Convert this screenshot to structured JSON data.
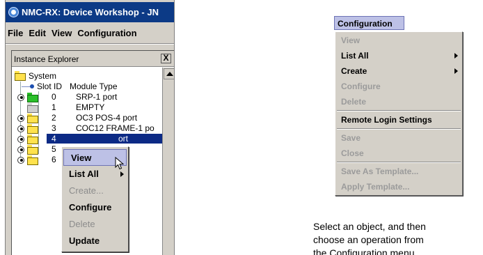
{
  "window": {
    "title": "NMC-RX: Device Workshop - JN",
    "menu": [
      "File",
      "Edit",
      "View",
      "Configuration"
    ]
  },
  "instance_explorer": {
    "title": "Instance Explorer",
    "close_label": "X",
    "root": "System",
    "columns": {
      "slot": "Slot ID",
      "module": "Module Type"
    },
    "rows": [
      {
        "slot": "0",
        "module": "SRP-1 port",
        "folder": "green",
        "expandable": true
      },
      {
        "slot": "1",
        "module": "EMPTY",
        "folder": "grey",
        "expandable": false
      },
      {
        "slot": "2",
        "module": "OC3 POS-4 port",
        "folder": "yellow",
        "expandable": true
      },
      {
        "slot": "3",
        "module": "COC12 FRAME-1 po",
        "folder": "yellow",
        "expandable": true
      },
      {
        "slot": "4",
        "module": "OC12 ATM-1 port",
        "folder": "yellow",
        "expandable": true,
        "selected": true
      },
      {
        "slot": "5",
        "module": "",
        "module_tail": "ort",
        "folder": "yellow",
        "expandable": true
      },
      {
        "slot": "6",
        "module": "",
        "folder": "yellow",
        "expandable": true
      }
    ],
    "row4_visible_tail": "ort"
  },
  "context_menu": {
    "items": [
      {
        "label": "View",
        "enabled": true,
        "hover": true
      },
      {
        "label": "List All",
        "enabled": true,
        "submenu": true
      },
      {
        "label": "Create...",
        "enabled": false
      },
      {
        "label": "Configure",
        "enabled": true
      },
      {
        "label": "Delete",
        "enabled": false
      },
      {
        "label": "Update",
        "enabled": true
      }
    ]
  },
  "configuration_menu": {
    "title": "Configuration",
    "items": [
      {
        "label": "View",
        "enabled": false
      },
      {
        "label": "List All",
        "enabled": true,
        "submenu": true
      },
      {
        "label": "Create",
        "enabled": true,
        "submenu": true
      },
      {
        "label": "Configure",
        "enabled": false
      },
      {
        "label": "Delete",
        "enabled": false
      },
      {
        "label": "Remote Login Settings",
        "enabled": true
      },
      {
        "label": "Save",
        "enabled": false
      },
      {
        "label": "Close",
        "enabled": false
      },
      {
        "label": "Save As Template...",
        "enabled": false
      },
      {
        "label": "Apply Template...",
        "enabled": false
      }
    ]
  },
  "caption": {
    "line1": "Select an object, and then",
    "line2": "choose an operation from",
    "line3": "the Configuration menu."
  },
  "colors": {
    "title_bar": "#0c3a86",
    "selection": "#0c2a85",
    "hover": "#bdc1e6",
    "disabled_text": "#8c8c8c"
  }
}
